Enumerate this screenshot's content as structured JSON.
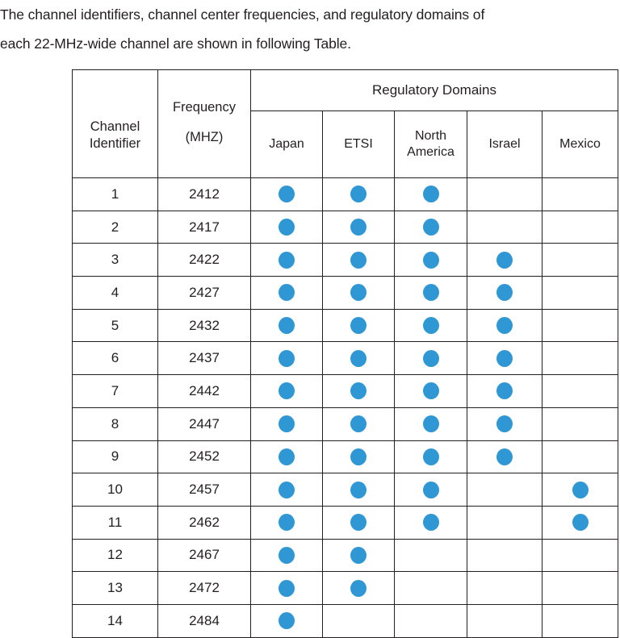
{
  "document": {
    "intro_line1": "The channel identifiers, channel center frequencies, and regulatory domains of",
    "intro_line2": "each 22-MHz-wide channel are shown in following Table."
  },
  "table": {
    "header": {
      "channel_identifier": "Channel",
      "channel_identifier_line2": "Identifier",
      "frequency": "Frequency",
      "frequency_unit": "(MHZ)",
      "group_label": "Regulatory Domains",
      "domains": [
        "Japan",
        "ETSI",
        "North America",
        "Israel",
        "Mexico"
      ],
      "domain_na_line1": "North",
      "domain_na_line2": "America"
    },
    "dot_color": "#2e97d4",
    "border_color": "#231f20",
    "columns": [
      "Channel Identifier",
      "Frequency (MHZ)",
      "Japan",
      "ETSI",
      "North America",
      "Israel",
      "Mexico"
    ],
    "rows": [
      {
        "channel": "1",
        "frequency": "2412",
        "japan": true,
        "etsi": true,
        "north_america": true,
        "israel": false,
        "mexico": false
      },
      {
        "channel": "2",
        "frequency": "2417",
        "japan": true,
        "etsi": true,
        "north_america": true,
        "israel": false,
        "mexico": false
      },
      {
        "channel": "3",
        "frequency": "2422",
        "japan": true,
        "etsi": true,
        "north_america": true,
        "israel": true,
        "mexico": false
      },
      {
        "channel": "4",
        "frequency": "2427",
        "japan": true,
        "etsi": true,
        "north_america": true,
        "israel": true,
        "mexico": false
      },
      {
        "channel": "5",
        "frequency": "2432",
        "japan": true,
        "etsi": true,
        "north_america": true,
        "israel": true,
        "mexico": false
      },
      {
        "channel": "6",
        "frequency": "2437",
        "japan": true,
        "etsi": true,
        "north_america": true,
        "israel": true,
        "mexico": false
      },
      {
        "channel": "7",
        "frequency": "2442",
        "japan": true,
        "etsi": true,
        "north_america": true,
        "israel": true,
        "mexico": false
      },
      {
        "channel": "8",
        "frequency": "2447",
        "japan": true,
        "etsi": true,
        "north_america": true,
        "israel": true,
        "mexico": false
      },
      {
        "channel": "9",
        "frequency": "2452",
        "japan": true,
        "etsi": true,
        "north_america": true,
        "israel": true,
        "mexico": false
      },
      {
        "channel": "10",
        "frequency": "2457",
        "japan": true,
        "etsi": true,
        "north_america": true,
        "israel": false,
        "mexico": true
      },
      {
        "channel": "11",
        "frequency": "2462",
        "japan": true,
        "etsi": true,
        "north_america": true,
        "israel": false,
        "mexico": true
      },
      {
        "channel": "12",
        "frequency": "2467",
        "japan": true,
        "etsi": true,
        "north_america": false,
        "israel": false,
        "mexico": false
      },
      {
        "channel": "13",
        "frequency": "2472",
        "japan": true,
        "etsi": true,
        "north_america": false,
        "israel": false,
        "mexico": false
      },
      {
        "channel": "14",
        "frequency": "2484",
        "japan": true,
        "etsi": false,
        "north_america": false,
        "israel": false,
        "mexico": false
      }
    ]
  }
}
